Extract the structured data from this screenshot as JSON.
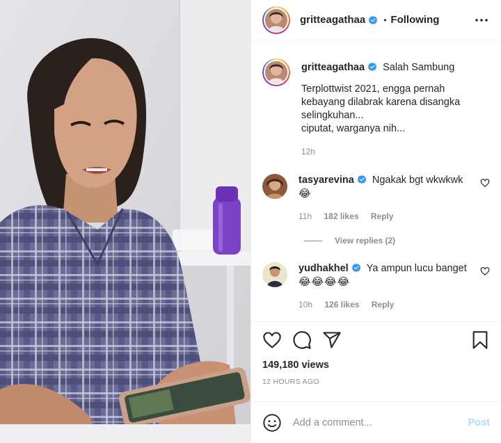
{
  "header": {
    "username": "gritteagathaa",
    "separator": "•",
    "follow_state": "Following"
  },
  "caption": {
    "username": "gritteagathaa",
    "title": "Salah Sambung",
    "text": "Terplottwist 2021, engga pernah\nkebayang dilabrak karena disangka\nselingkuhan...\nciputat, warganya nih...",
    "time": "12h"
  },
  "comments": [
    {
      "username": "tasyarevina",
      "text": "Ngakak bgt wkwkwk",
      "emoji": "😂",
      "time": "11h",
      "likes": "182 likes",
      "reply": "Reply"
    },
    {
      "username": "yudhakhel",
      "text": "Ya ampun lucu banget",
      "emoji": "😂😂😂😂",
      "time": "10h",
      "likes": "126 likes",
      "reply": "Reply"
    }
  ],
  "view_replies": "View replies (2)",
  "stats": {
    "views": "149,180 views",
    "timestamp": "12 HOURS AGO"
  },
  "composer": {
    "placeholder": "Add a comment...",
    "post_label": "Post"
  },
  "icons": {
    "like": "heart-icon",
    "comment": "comment-icon",
    "share": "share-icon",
    "save": "bookmark-icon",
    "more": "more-options-icon",
    "emoji": "emoji-icon",
    "verified": "verified-badge-icon"
  },
  "colors": {
    "verified": "#3897f0",
    "post_disabled": "#b3dbff",
    "muted_text": "#8e8e8e"
  }
}
